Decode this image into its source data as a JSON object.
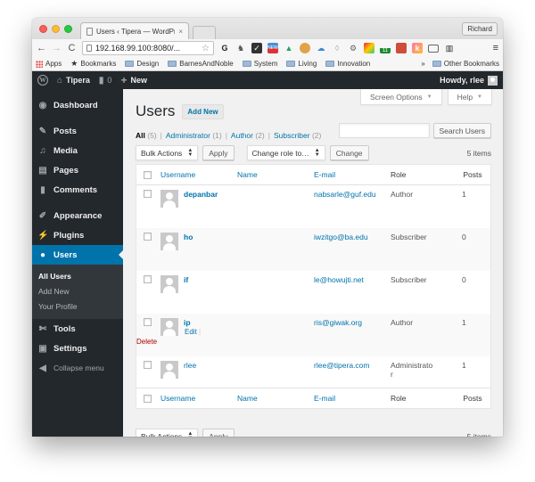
{
  "browser": {
    "tab_title": "Users ‹ Tipera — WordPress",
    "tab_close": "×",
    "profile": "Richard",
    "url": "192.168.99.100:8080/...",
    "extensions": [
      "grammarly-icon",
      "evernote-icon",
      "checkmark-icon",
      "chrome-new-icon",
      "google-drive-icon",
      "cookie-icon",
      "cloud-icon",
      "shield-icon",
      "gear-icon",
      "color-app-icon",
      "activity-badge-icon",
      "red-book-icon",
      "k-app-icon",
      "cast-icon",
      "traffic-light-icon"
    ],
    "activity_badge": "11",
    "new_badge": "NEW",
    "bookmarks": [
      {
        "label": "Apps",
        "icon": "apps-grid-icon"
      },
      {
        "label": "Bookmarks",
        "icon": "star-icon"
      },
      {
        "label": "Design",
        "icon": "folder-icon"
      },
      {
        "label": "BarnesAndNoble",
        "icon": "folder-icon"
      },
      {
        "label": "System",
        "icon": "folder-icon"
      },
      {
        "label": "Living",
        "icon": "folder-icon"
      },
      {
        "label": "Innovation",
        "icon": "folder-icon"
      }
    ],
    "overflow": "»",
    "other_bookmarks": "Other Bookmarks"
  },
  "adminbar": {
    "site_name": "Tipera",
    "comments_count": "0",
    "new_label": "New",
    "howdy": "Howdy, rlee"
  },
  "sidebar": {
    "items": [
      {
        "label": "Dashboard",
        "icon": "dashboard-icon"
      },
      {
        "label": "Posts",
        "icon": "pin-icon"
      },
      {
        "label": "Media",
        "icon": "media-icon"
      },
      {
        "label": "Pages",
        "icon": "pages-icon"
      },
      {
        "label": "Comments",
        "icon": "comment-icon"
      },
      {
        "label": "Appearance",
        "icon": "brush-icon"
      },
      {
        "label": "Plugins",
        "icon": "plugin-icon"
      },
      {
        "label": "Users",
        "icon": "user-icon"
      },
      {
        "label": "Tools",
        "icon": "wrench-icon"
      },
      {
        "label": "Settings",
        "icon": "settings-icon"
      }
    ],
    "submenu": [
      "All Users",
      "Add New",
      "Your Profile"
    ],
    "collapse": "Collapse menu"
  },
  "screen_meta": {
    "screen_options": "Screen Options",
    "help": "Help"
  },
  "page": {
    "title": "Users",
    "add_new": "Add New",
    "filters": [
      {
        "label": "All",
        "count": "(5)"
      },
      {
        "label": "Administrator",
        "count": "(1)"
      },
      {
        "label": "Author",
        "count": "(2)"
      },
      {
        "label": "Subscriber",
        "count": "(2)"
      }
    ],
    "filter_sep": "|",
    "search_value": "",
    "search_button": "Search Users",
    "bulk_actions": "Bulk Actions",
    "apply": "Apply",
    "change_role": "Change role to…",
    "change": "Change",
    "items_count": "5 items"
  },
  "table": {
    "columns": [
      "Username",
      "Name",
      "E-mail",
      "Role",
      "Posts"
    ],
    "rows": [
      {
        "username": "depanbar",
        "name": "",
        "email": "nabsarle@guf.edu",
        "role": "Author",
        "posts": "1"
      },
      {
        "username": "ho",
        "name": "",
        "email": "iwzitgo@ba.edu",
        "role": "Subscriber",
        "posts": "0"
      },
      {
        "username": "if",
        "name": "",
        "email": "le@howujti.net",
        "role": "Subscriber",
        "posts": "0"
      },
      {
        "username": "ip",
        "name": "",
        "email": "ris@giwak.org",
        "role": "Author",
        "posts": "1",
        "actions": {
          "edit": "Edit",
          "sep": "|",
          "delete": "Delete"
        }
      },
      {
        "username": "rlee",
        "name": "",
        "email": "rlee@tipera.com",
        "role": "Administrator",
        "posts": "1"
      }
    ]
  }
}
